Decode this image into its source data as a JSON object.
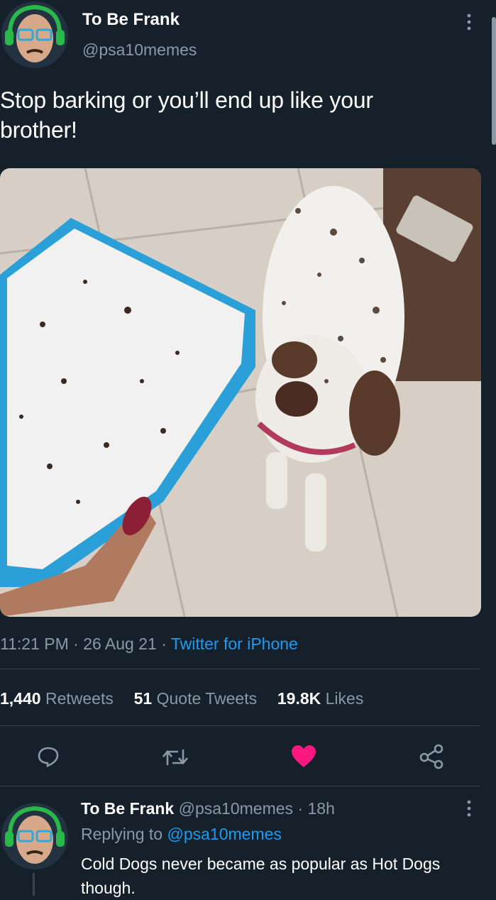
{
  "tweet": {
    "author_name": "To Be Frank",
    "handle": "@psa10memes",
    "text": "Stop barking or you’ll end up like your brother!",
    "time": "11:21 PM",
    "date": "26 Aug 21",
    "source": "Twitter for iPhone",
    "sep": "·"
  },
  "stats": {
    "retweets_count": "1,440",
    "retweets_label": "Retweets",
    "quotes_count": "51",
    "quotes_label": "Quote Tweets",
    "likes_count": "19.8K",
    "likes_label": "Likes"
  },
  "actions": {
    "reply_icon": "reply-icon",
    "retweet_icon": "retweet-icon",
    "like_icon": "heart-filled-icon",
    "share_icon": "share-icon",
    "like_color": "#f91880"
  },
  "reply": {
    "author_name": "To Be Frank",
    "handle": "@psa10memes",
    "age": "18h",
    "replying_prefix": "Replying to",
    "replying_to": "@psa10memes",
    "text": "Cold Dogs never became as popular as Hot Dogs though."
  },
  "colors": {
    "background": "#15202b",
    "muted": "#8b98a5",
    "link": "#1d9bf0"
  }
}
